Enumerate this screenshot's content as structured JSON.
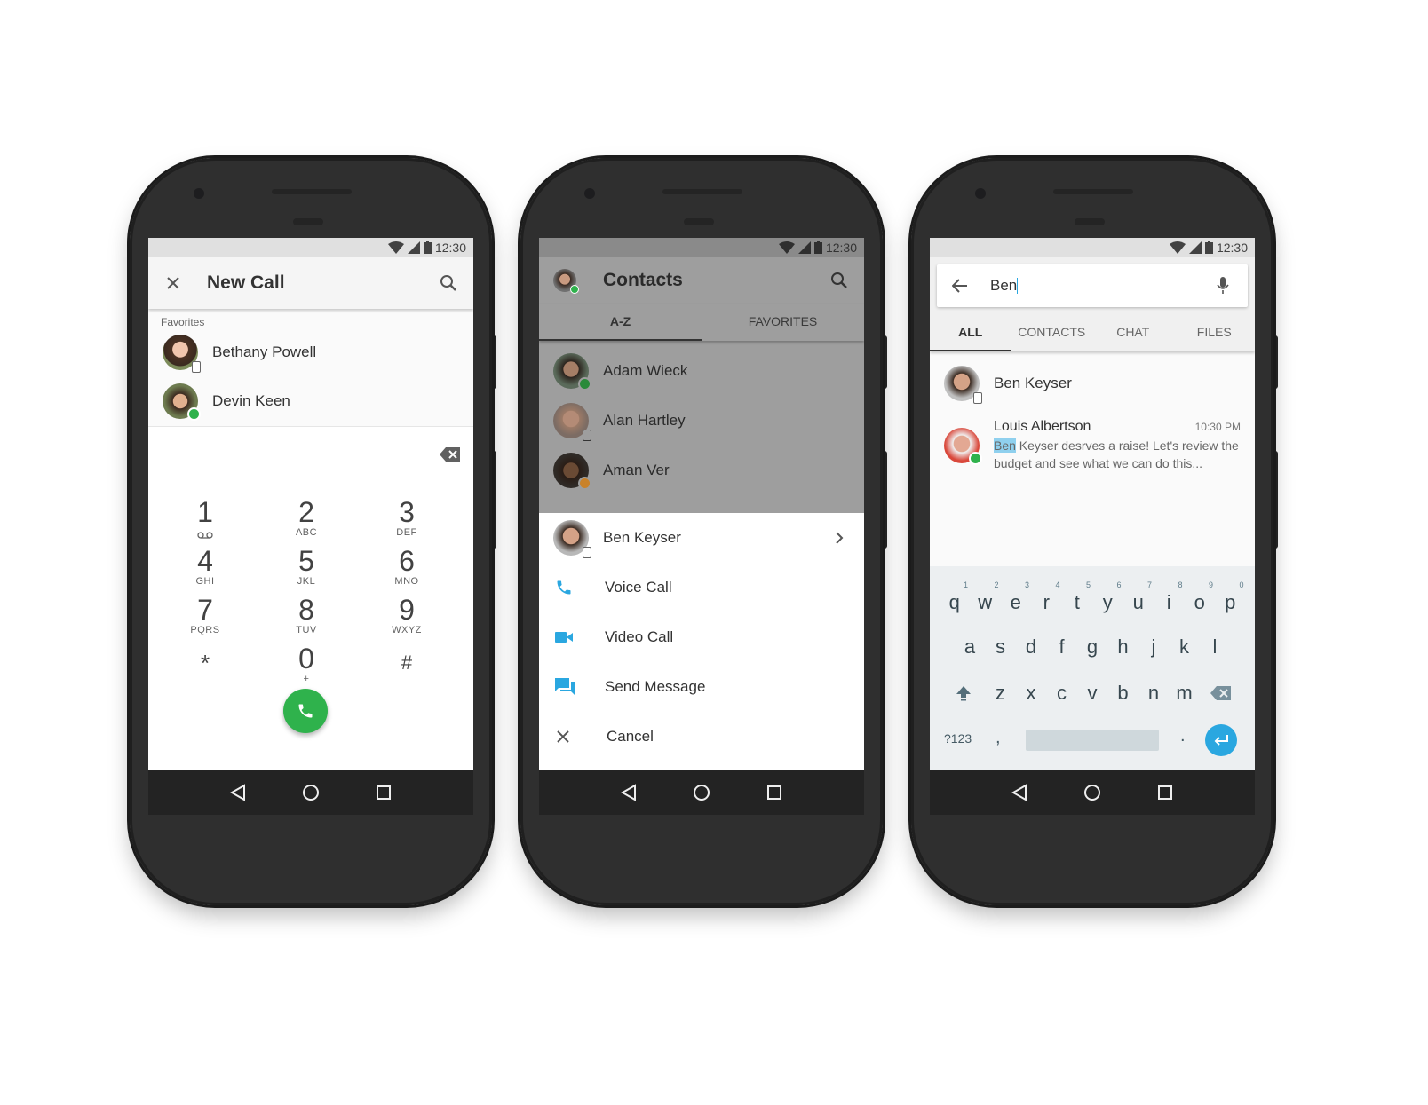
{
  "status": {
    "time": "12:30"
  },
  "phone1": {
    "title": "New Call",
    "favorites_label": "Favorites",
    "favorites": [
      {
        "name": "Bethany Powell",
        "presence": "mobile"
      },
      {
        "name": "Devin Keen",
        "presence": "online"
      }
    ],
    "keys": [
      {
        "digit": "1",
        "letters": ""
      },
      {
        "digit": "2",
        "letters": "ABC"
      },
      {
        "digit": "3",
        "letters": "DEF"
      },
      {
        "digit": "4",
        "letters": "GHI"
      },
      {
        "digit": "5",
        "letters": "JKL"
      },
      {
        "digit": "6",
        "letters": "MNO"
      },
      {
        "digit": "7",
        "letters": "PQRS"
      },
      {
        "digit": "8",
        "letters": "TUV"
      },
      {
        "digit": "9",
        "letters": "WXYZ"
      },
      {
        "digit": "*",
        "letters": ""
      },
      {
        "digit": "0",
        "letters": "+"
      },
      {
        "digit": "#",
        "letters": ""
      }
    ],
    "call_color": "#2fb24c"
  },
  "phone2": {
    "title": "Contacts",
    "tabs": [
      "A-Z",
      "FAVORITES"
    ],
    "contacts": [
      "Adam Wieck",
      "Alan Hartley",
      "Aman Ver"
    ],
    "selected_contact": "Ben Keyser",
    "actions": [
      "Voice Call",
      "Video Call",
      "Send Message",
      "Cancel"
    ],
    "accent": "#2aa7e0"
  },
  "phone3": {
    "search_value": "Ben",
    "tabs": [
      "ALL",
      "CONTACTS",
      "CHAT",
      "FILES"
    ],
    "results": {
      "contact": "Ben Keyser",
      "message": {
        "sender": "Louis Albertson",
        "time": "10:30 PM",
        "highlight": "Ben",
        "text_line1_rest": " Keyser desrves a raise! Let's review the",
        "text_line2": "budget and see what we can do this..."
      }
    },
    "keyboard": {
      "row1": [
        "q",
        "w",
        "e",
        "r",
        "t",
        "y",
        "u",
        "i",
        "o",
        "p"
      ],
      "row1_hints": [
        "1",
        "2",
        "3",
        "4",
        "5",
        "6",
        "7",
        "8",
        "9",
        "0"
      ],
      "row2": [
        "a",
        "s",
        "d",
        "f",
        "g",
        "h",
        "j",
        "k",
        "l"
      ],
      "row3": [
        "z",
        "x",
        "c",
        "v",
        "b",
        "n",
        "m"
      ],
      "symbols_key": "?123",
      "comma": ",",
      "period": "."
    }
  }
}
